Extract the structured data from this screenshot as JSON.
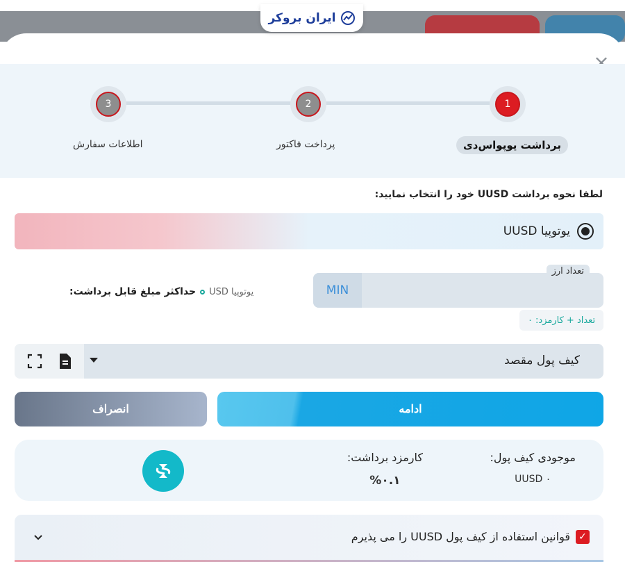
{
  "logo": {
    "text": "ایران بروکر",
    "icon": "broker-logo-icon"
  },
  "close": {
    "label": "×"
  },
  "stepper": {
    "steps": [
      {
        "number": "1",
        "label": "برداشت یوپواس‌دی",
        "active": true
      },
      {
        "number": "2",
        "label": "پرداخت فاکتور",
        "active": false
      },
      {
        "number": "3",
        "label": "اطلاعات سفارش",
        "active": false
      }
    ]
  },
  "form": {
    "prompt": "لطفا نحوه برداشت UUSD خود را انتخاب نمایید:",
    "method_option": "یوتوپیا UUSD",
    "amount_label": "تعداد ارز",
    "min_label": "MIN",
    "fee_total": "تعداد + کارمزد: ۰",
    "max_label": "حداکثر مبلغ قابل برداشت:",
    "max_value": "یوتوپیا USD",
    "wallet_placeholder": "کیف پول مقصد"
  },
  "actions": {
    "continue": "ادامه",
    "cancel": "انصراف"
  },
  "info": {
    "balance_title": "موجودی کیف پول:",
    "balance_value": "UUSD ۰",
    "fee_title": "کارمزد برداشت:",
    "fee_value": "%۰.۱",
    "coin_icon": "utopia-usd-coin-icon"
  },
  "terms": {
    "label": "قوانین استفاده از کیف پول UUSD را می پذیرم",
    "checked": true
  },
  "colors": {
    "accent_red": "#dc1c22",
    "accent_blue": "#0fa6e6",
    "teal": "#13b9c9"
  }
}
